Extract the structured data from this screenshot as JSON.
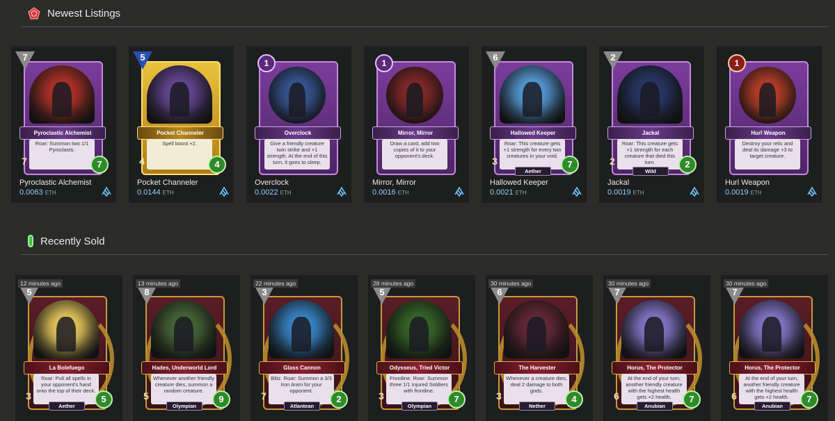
{
  "newest": {
    "title": "Newest Listings",
    "items": [
      {
        "name": "Pyroclastic Alchemist",
        "price": "0.0063",
        "unit": "ETH",
        "mana": "7",
        "mana_style": "gray",
        "attack": "7",
        "health": "7",
        "text": "Roar: Summon two 1/1 Pyroclasts.",
        "tribe": "",
        "frame": "purple",
        "art": "#b8342a"
      },
      {
        "name": "Pocket Channeler",
        "price": "0.0144",
        "unit": "ETH",
        "mana": "5",
        "mana_style": "blue",
        "attack": "4",
        "health": "4",
        "text": "Spell boost +2.",
        "tribe": "",
        "frame": "gold",
        "art": "#6a4a9a"
      },
      {
        "name": "Overclock",
        "price": "0.0022",
        "unit": "ETH",
        "mana": "1",
        "mana_style": "circle",
        "attack": "",
        "health": "",
        "text": "Give a friendly creature twin strike and +1 strength. At the end of this turn, it goes to sleep.",
        "tribe": "",
        "frame": "purple",
        "art": "#3a5a9a"
      },
      {
        "name": "Mirror, Mirror",
        "price": "0.0016",
        "unit": "ETH",
        "mana": "1",
        "mana_style": "circle",
        "attack": "",
        "health": "",
        "text": "Draw a card, add two copies of it to your opponent's deck.",
        "tribe": "",
        "frame": "purple",
        "art": "#8a2a2a"
      },
      {
        "name": "Hallowed Keeper",
        "price": "0.0021",
        "unit": "ETH",
        "mana": "6",
        "mana_style": "gray",
        "attack": "3",
        "health": "7",
        "text": "Roar: This creature gets +1 strength for every two creatures in your void.",
        "tribe": "Aether",
        "frame": "purple",
        "art": "#5aa0e0"
      },
      {
        "name": "Jackal",
        "price": "0.0019",
        "unit": "ETH",
        "mana": "2",
        "mana_style": "gray",
        "attack": "2",
        "health": "2",
        "text": "Roar: This creature gets +1 strength for each creature that died this turn.",
        "tribe": "Wild",
        "frame": "purple",
        "art": "#2a3a6a"
      },
      {
        "name": "Hurl Weapon",
        "price": "0.0019",
        "unit": "ETH",
        "mana": "1",
        "mana_style": "red",
        "attack": "",
        "health": "",
        "text": "Destroy your relic and deal its damage +3 to target creature.",
        "tribe": "",
        "frame": "purple",
        "art": "#c0402a"
      }
    ]
  },
  "sold": {
    "title": "Recently Sold",
    "items": [
      {
        "time": "12 minutes ago",
        "name": "La Bolefuego",
        "mana": "5",
        "attack": "3",
        "health": "5",
        "text": "Roar: Pull all spells in your opponent's hand onto the top of their deck.",
        "tribe": "Aether",
        "art": "#f0d060"
      },
      {
        "time": "13 minutes ago",
        "name": "Hades, Underworld Lord",
        "mana": "8",
        "attack": "5",
        "health": "9",
        "text": "Whenever another friendly creature dies, summon a random creature.",
        "tribe": "Olympian",
        "art": "#4a6a3a"
      },
      {
        "time": "22 minutes ago",
        "name": "Glass Cannon",
        "mana": "3",
        "attack": "7",
        "health": "2",
        "text": "Blitz. Roar: Summon a 3/3 Iron Anim for your opponent.",
        "tribe": "Atlantean",
        "art": "#3a8ad0"
      },
      {
        "time": "28 minutes ago",
        "name": "Odysseus, Tried Victor",
        "mana": "5",
        "attack": "3",
        "health": "7",
        "text": "Frontline. Roar: Summon three 1/1 Injured Soldiers with frontline.",
        "tribe": "Olympian",
        "art": "#3a6a2a"
      },
      {
        "time": "30 minutes ago",
        "name": "The Harvester",
        "mana": "6",
        "attack": "3",
        "health": "4",
        "text": "Whenever a creature dies, deal 2 damage to both gods.",
        "tribe": "Nether",
        "art": "#6a2a3a"
      },
      {
        "time": "30 minutes ago",
        "name": "Horus, The Protector",
        "mana": "7",
        "attack": "6",
        "health": "7",
        "text": "At the end of your turn, another friendly creature with the highest health gets +2 health.",
        "tribe": "Anubian",
        "art": "#8a7ad0"
      },
      {
        "time": "30 minutes ago",
        "name": "Horus, The Protector",
        "mana": "7",
        "attack": "6",
        "health": "7",
        "text": "At the end of your turn, another friendly creature with the highest health gets +2 health.",
        "tribe": "Anubian",
        "art": "#8a7ad0"
      }
    ]
  }
}
